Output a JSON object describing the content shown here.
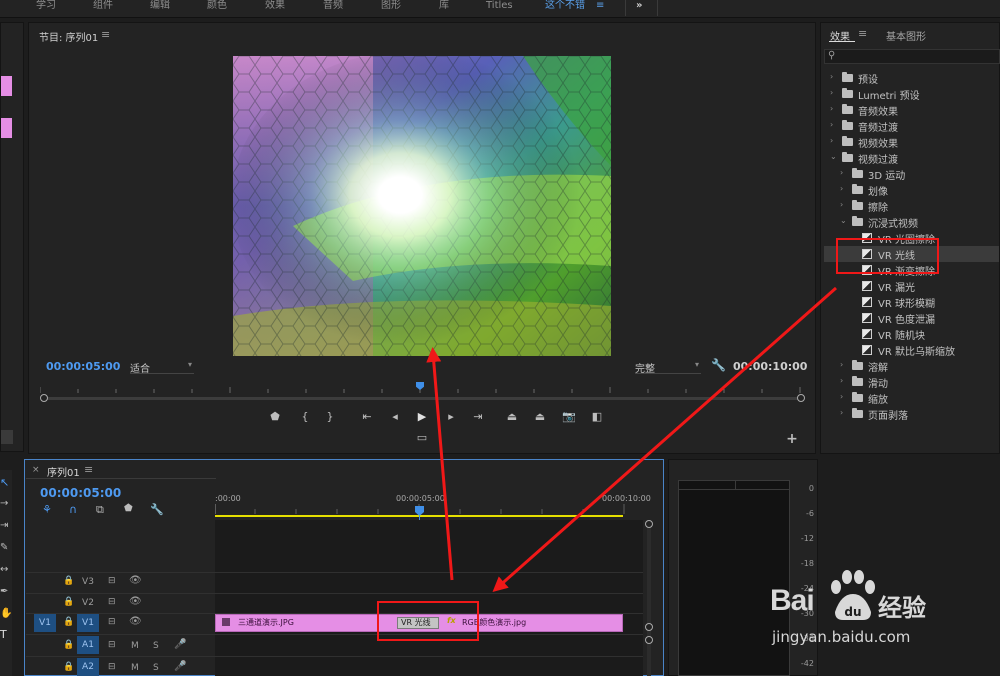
{
  "workspace_tabs": [
    "学习",
    "组件",
    "编辑",
    "颜色",
    "效果",
    "音频",
    "图形",
    "库",
    "Titles",
    "这个不错"
  ],
  "program_monitor": {
    "title": "节目: 序列01",
    "timecode_current": "00:00:05:00",
    "zoom_select": "适合",
    "quality_select": "完整",
    "timecode_duration": "00:00:10:00"
  },
  "effects_panel": {
    "tabs": [
      "效果",
      "基本图形"
    ],
    "search_placeholder": "",
    "tree": [
      {
        "label": "预设",
        "level": 0,
        "kind": "folder",
        "expanded": false
      },
      {
        "label": "Lumetri 预设",
        "level": 0,
        "kind": "folder",
        "expanded": false
      },
      {
        "label": "音频效果",
        "level": 0,
        "kind": "folder",
        "expanded": false
      },
      {
        "label": "音频过渡",
        "level": 0,
        "kind": "folder",
        "expanded": false
      },
      {
        "label": "视频效果",
        "level": 0,
        "kind": "folder",
        "expanded": false
      },
      {
        "label": "视频过渡",
        "level": 0,
        "kind": "folder",
        "expanded": true
      },
      {
        "label": "3D 运动",
        "level": 1,
        "kind": "folder",
        "expanded": false
      },
      {
        "label": "划像",
        "level": 1,
        "kind": "folder",
        "expanded": false
      },
      {
        "label": "擦除",
        "level": 1,
        "kind": "folder",
        "expanded": false
      },
      {
        "label": "沉浸式视频",
        "level": 1,
        "kind": "folder",
        "expanded": true
      },
      {
        "label": "VR 光圈擦除",
        "level": 2,
        "kind": "effect"
      },
      {
        "label": "VR 光线",
        "level": 2,
        "kind": "effect",
        "selected": true
      },
      {
        "label": "VR 渐变擦除",
        "level": 2,
        "kind": "effect"
      },
      {
        "label": "VR 漏光",
        "level": 2,
        "kind": "effect"
      },
      {
        "label": "VR 球形模糊",
        "level": 2,
        "kind": "effect"
      },
      {
        "label": "VR 色度泄漏",
        "level": 2,
        "kind": "effect"
      },
      {
        "label": "VR 随机块",
        "level": 2,
        "kind": "effect"
      },
      {
        "label": "VR 默比乌斯缩放",
        "level": 2,
        "kind": "effect"
      },
      {
        "label": "溶解",
        "level": 1,
        "kind": "folder",
        "expanded": false
      },
      {
        "label": "滑动",
        "level": 1,
        "kind": "folder",
        "expanded": false
      },
      {
        "label": "缩放",
        "level": 1,
        "kind": "folder",
        "expanded": false
      },
      {
        "label": "页面剥落",
        "level": 1,
        "kind": "folder",
        "expanded": false
      }
    ]
  },
  "timeline": {
    "close_glyph": "×",
    "title": "序列01",
    "timecode": "00:00:05:00",
    "ruler_labels": [
      ":00:00",
      "00:00:05:00",
      "00:00:10:00"
    ],
    "tracks": [
      {
        "name": "V3"
      },
      {
        "name": "V2"
      },
      {
        "name": "V1",
        "source": "V1"
      },
      {
        "name": "A1",
        "extra": [
          "M",
          "S"
        ]
      },
      {
        "name": "A2",
        "extra": [
          "M",
          "S"
        ]
      }
    ],
    "clips": {
      "clip_a": "三通道演示.JPG",
      "transition": "VR 光线",
      "fx_badge": "fx",
      "clip_b": "RGB颜色演示.jpg"
    }
  },
  "audio_meter": {
    "labels": [
      "0",
      "-6",
      "-12",
      "-18",
      "-24",
      "-30",
      "-36",
      "-42"
    ]
  },
  "watermark": {
    "brand": "Bai",
    "brand_cn": "经验",
    "url": "jingyan.baidu.com"
  },
  "colors": {
    "accent_blue": "#4e9af1",
    "clip_pink": "#e58ee5",
    "annotation_red": "#f01818",
    "playhead_blue": "#3f8fe8",
    "work_area_yellow": "#e6e000"
  }
}
